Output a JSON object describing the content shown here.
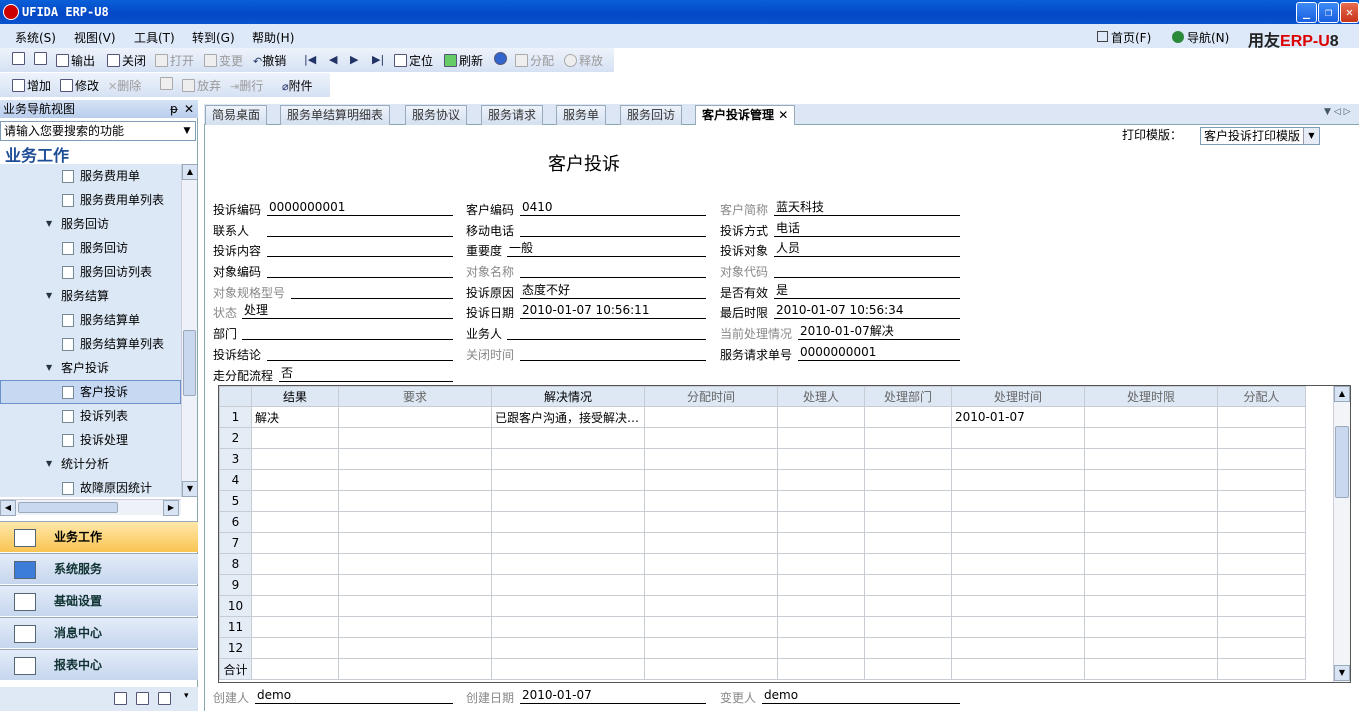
{
  "window": {
    "title": "UFIDA ERP-U8",
    "min": "_",
    "restore": "❐",
    "close": "✕"
  },
  "menu": [
    "系统(S)",
    "视图(V)",
    "工具(T)",
    "转到(G)",
    "帮助(H)"
  ],
  "topright": {
    "home": "首页(F)",
    "nav": "导航(N)",
    "brand_a": "用友",
    "brand_b": "ERP-U",
    "brand_c": "8"
  },
  "toolbar1": [
    {
      "label": "",
      "disabled": false
    },
    {
      "label": "",
      "disabled": false
    },
    {
      "label": "输出",
      "disabled": false
    },
    {
      "label": "关闭",
      "disabled": false
    },
    {
      "label": "打开",
      "disabled": true
    },
    {
      "label": "变更",
      "disabled": true
    },
    {
      "label": "撤销",
      "disabled": false
    },
    {
      "label": "定位",
      "disabled": false
    },
    {
      "label": "刷新",
      "disabled": false
    },
    {
      "label": "分配",
      "disabled": true
    },
    {
      "label": "释放",
      "disabled": true
    }
  ],
  "toolbar2": [
    {
      "label": "增加",
      "disabled": false
    },
    {
      "label": "修改",
      "disabled": false
    },
    {
      "label": "删除",
      "disabled": true
    },
    {
      "label": "",
      "disabled": true
    },
    {
      "label": "放弃",
      "disabled": true
    },
    {
      "label": "删行",
      "disabled": true
    },
    {
      "label": "附件",
      "disabled": false
    }
  ],
  "nav": {
    "title": "业务导航视图",
    "pin": "ᵽ",
    "close": "✕",
    "search_placeholder": "请输入您要搜索的功能",
    "section": "业务工作",
    "items": [
      {
        "label": "服务费用单",
        "type": "leaf"
      },
      {
        "label": "服务费用单列表",
        "type": "leaf"
      },
      {
        "label": "服务回访",
        "type": "group"
      },
      {
        "label": "服务回访",
        "type": "leaf"
      },
      {
        "label": "服务回访列表",
        "type": "leaf"
      },
      {
        "label": "服务结算",
        "type": "group"
      },
      {
        "label": "服务结算单",
        "type": "leaf"
      },
      {
        "label": "服务结算单列表",
        "type": "leaf"
      },
      {
        "label": "客户投诉",
        "type": "group"
      },
      {
        "label": "客户投诉",
        "type": "leaf",
        "selected": true
      },
      {
        "label": "投诉列表",
        "type": "leaf"
      },
      {
        "label": "投诉处理",
        "type": "leaf"
      },
      {
        "label": "统计分析",
        "type": "group"
      },
      {
        "label": "故障原因统计",
        "type": "leaf"
      }
    ],
    "modules": [
      "业务工作",
      "系统服务",
      "基础设置",
      "消息中心",
      "报表中心"
    ]
  },
  "tabs": [
    "简易桌面",
    "服务单结算明细表",
    "服务协议",
    "服务请求",
    "服务单",
    "服务回访",
    "客户投诉管理"
  ],
  "active_tab_close": "✕",
  "print_template": {
    "label": "打印模版：",
    "value": "客户投诉打印模版"
  },
  "form": {
    "title": "客户投诉",
    "fields": [
      {
        "label": "投诉编码",
        "value": "0000000001"
      },
      {
        "label": "客户编码",
        "value": "0410"
      },
      {
        "label": "客户简称",
        "value": "蓝天科技"
      },
      {
        "label": "联系人",
        "value": ""
      },
      {
        "label": "移动电话",
        "value": ""
      },
      {
        "label": "投诉方式",
        "value": "电话"
      },
      {
        "label": "投诉内容",
        "value": ""
      },
      {
        "label": "重要度",
        "value": "一般"
      },
      {
        "label": "投诉对象",
        "value": "人员"
      },
      {
        "label": "对象编码",
        "value": ""
      },
      {
        "label": "对象名称",
        "value": ""
      },
      {
        "label": "对象代码",
        "value": ""
      },
      {
        "label": "对象规格型号",
        "value": ""
      },
      {
        "label": "投诉原因",
        "value": "态度不好"
      },
      {
        "label": "是否有效",
        "value": "是"
      },
      {
        "label": "状态",
        "value": "处理"
      },
      {
        "label": "投诉日期",
        "value": "2010-01-07 10:56:11"
      },
      {
        "label": "最后时限",
        "value": "2010-01-07 10:56:34"
      },
      {
        "label": "部门",
        "value": ""
      },
      {
        "label": "业务人",
        "value": ""
      },
      {
        "label": "当前处理情况",
        "value": "2010-01-07解决"
      },
      {
        "label": "投诉结论",
        "value": ""
      },
      {
        "label": "关闭时间",
        "value": ""
      },
      {
        "label": "服务请求单号",
        "value": "0000000001"
      },
      {
        "label": "走分配流程",
        "value": "否"
      }
    ],
    "footer": [
      {
        "label": "创建人",
        "value": "demo"
      },
      {
        "label": "创建日期",
        "value": "2010-01-07"
      },
      {
        "label": "变更人",
        "value": "demo"
      }
    ]
  },
  "grid": {
    "columns": [
      "结果",
      "要求",
      "解决情况",
      "分配时间",
      "处理人",
      "处理部门",
      "处理时间",
      "处理时限",
      "分配人"
    ],
    "rows": [
      [
        "1",
        "解决",
        "",
        "已跟客户沟通，接受解决…",
        "",
        "",
        "",
        "2010-01-07",
        "",
        ""
      ],
      [
        "2",
        "",
        "",
        "",
        "",
        "",
        "",
        "",
        "",
        ""
      ],
      [
        "3",
        "",
        "",
        "",
        "",
        "",
        "",
        "",
        "",
        ""
      ],
      [
        "4",
        "",
        "",
        "",
        "",
        "",
        "",
        "",
        "",
        ""
      ],
      [
        "5",
        "",
        "",
        "",
        "",
        "",
        "",
        "",
        "",
        ""
      ],
      [
        "6",
        "",
        "",
        "",
        "",
        "",
        "",
        "",
        "",
        ""
      ],
      [
        "7",
        "",
        "",
        "",
        "",
        "",
        "",
        "",
        "",
        ""
      ],
      [
        "8",
        "",
        "",
        "",
        "",
        "",
        "",
        "",
        "",
        ""
      ],
      [
        "9",
        "",
        "",
        "",
        "",
        "",
        "",
        "",
        "",
        ""
      ],
      [
        "10",
        "",
        "",
        "",
        "",
        "",
        "",
        "",
        "",
        ""
      ],
      [
        "11",
        "",
        "",
        "",
        "",
        "",
        "",
        "",
        "",
        ""
      ],
      [
        "12",
        "",
        "",
        "",
        "",
        "",
        "",
        "",
        "",
        ""
      ],
      [
        "合计",
        "",
        "",
        "",
        "",
        "",
        "",
        "",
        "",
        ""
      ]
    ]
  }
}
